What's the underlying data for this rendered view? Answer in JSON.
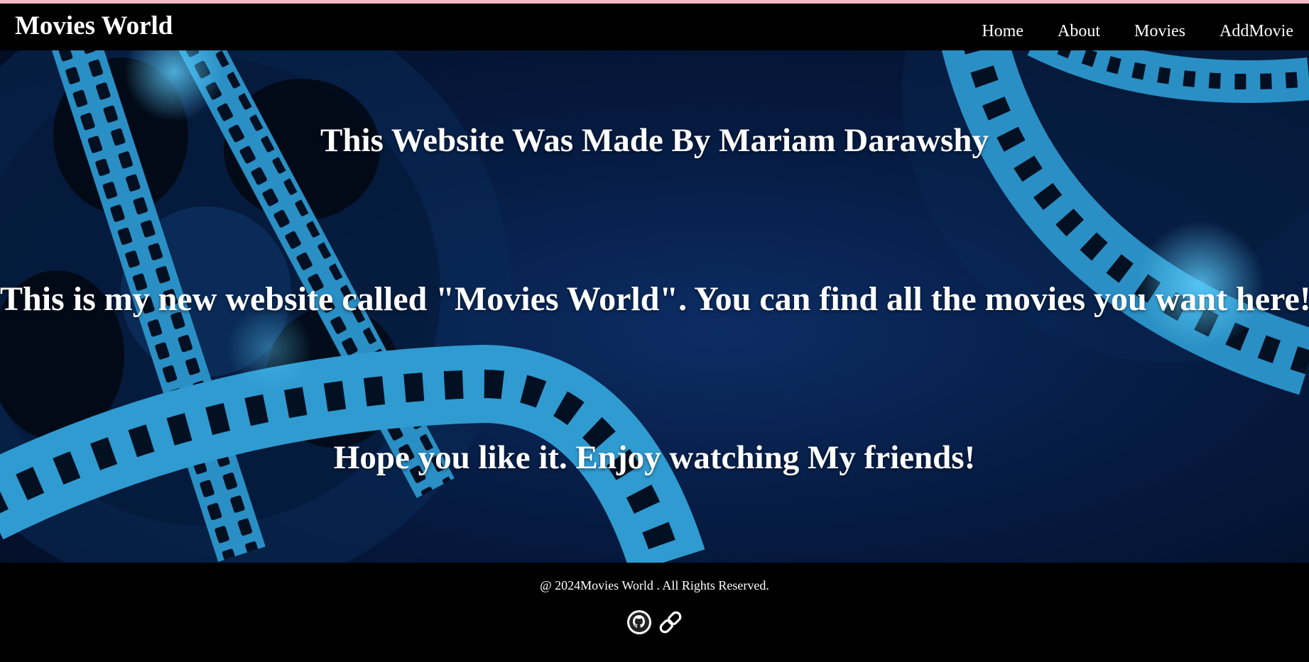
{
  "header": {
    "brand": "Movies World",
    "nav": [
      "Home",
      "About",
      "Movies",
      "AddMovie"
    ]
  },
  "hero": {
    "line1": "This Website Was Made By Mariam Darawshy",
    "line2": "This is my new website called \"Movies World\". You can find all the movies you want here!",
    "line3": "Hope you like it. Enjoy watching My friends!"
  },
  "footer": {
    "copyright": "@ 2024Movies World . All Rights Reserved.",
    "icons": [
      "github-icon",
      "link-icon"
    ]
  },
  "colors": {
    "accent_bar": "#f6b9c8",
    "background": "#000000",
    "hero_bg": "#061c44",
    "film_strip": "#2a8fc4"
  }
}
